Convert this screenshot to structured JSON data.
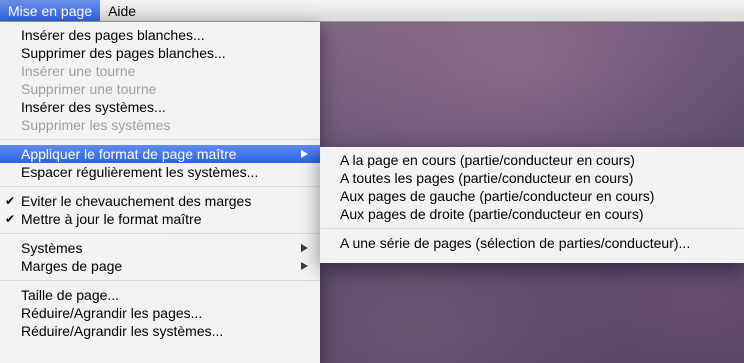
{
  "menubar": {
    "items": [
      {
        "label": "Mise en page"
      },
      {
        "label": "Aide"
      }
    ]
  },
  "menu": {
    "items": [
      {
        "label": "Insérer des pages blanches..."
      },
      {
        "label": "Supprimer des pages blanches..."
      },
      {
        "label": "Insérer une tourne"
      },
      {
        "label": "Supprimer une tourne"
      },
      {
        "label": "Insérer des systèmes..."
      },
      {
        "label": "Supprimer les systèmes"
      },
      {
        "label": "Appliquer le format de page maître"
      },
      {
        "label": "Espacer régulièrement les systèmes..."
      },
      {
        "label": "Eviter le chevauchement des marges"
      },
      {
        "label": "Mettre à jour le format maître"
      },
      {
        "label": "Systèmes"
      },
      {
        "label": "Marges de page"
      },
      {
        "label": "Taille de page..."
      },
      {
        "label": "Réduire/Agrandir les pages..."
      },
      {
        "label": "Réduire/Agrandir les systèmes..."
      }
    ]
  },
  "submenu": {
    "items": [
      {
        "label": "A la page en cours (partie/conducteur en cours)"
      },
      {
        "label": "A toutes les pages (partie/conducteur en cours)"
      },
      {
        "label": "Aux pages de gauche (partie/conducteur en cours)"
      },
      {
        "label": "Aux pages de droite (partie/conducteur en cours)"
      },
      {
        "label": "A une série de pages (sélection de parties/conducteur)..."
      }
    ]
  },
  "icons": {
    "check": "✔"
  }
}
